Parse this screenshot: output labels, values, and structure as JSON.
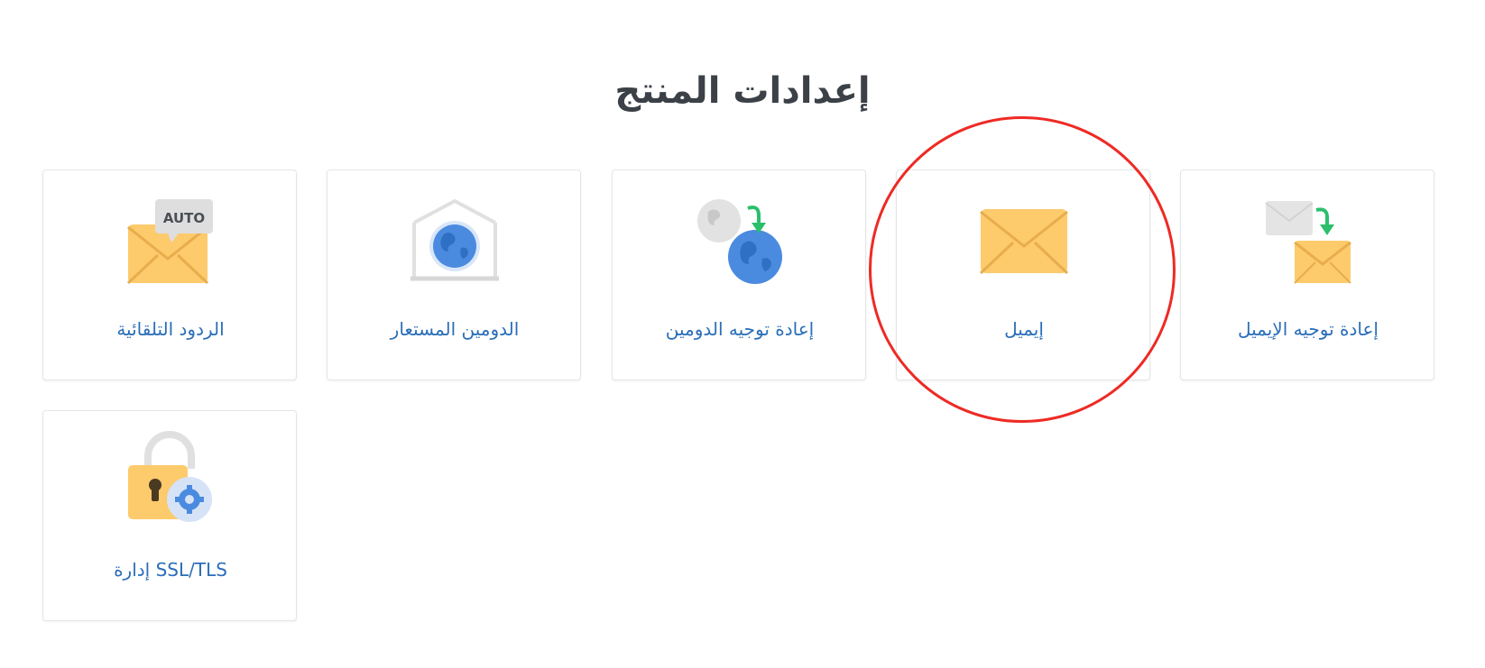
{
  "header": {
    "title": "إعدادات المنتج"
  },
  "cards": [
    {
      "label": "الردود التلقائية",
      "icon": "auto-responder-icon",
      "badge": "AUTO"
    },
    {
      "label": "الدومين المستعار",
      "icon": "alias-domain-icon"
    },
    {
      "label": "إعادة توجيه الدومين",
      "icon": "domain-forward-icon"
    },
    {
      "label": "إيميل",
      "icon": "email-icon",
      "highlighted": true
    },
    {
      "label": "إعادة توجيه الإيميل",
      "icon": "email-forward-icon"
    },
    {
      "label": "SSL/TLS إدارة",
      "icon": "ssl-tls-icon"
    }
  ],
  "colors": {
    "title": "#3b4147",
    "label": "#2a6eb8",
    "card_border": "#e3e6e9",
    "envelope": "#fdca6c",
    "globe": "#4a8be0",
    "arrow": "#2bbf6b",
    "highlight": "#ee2a24"
  }
}
